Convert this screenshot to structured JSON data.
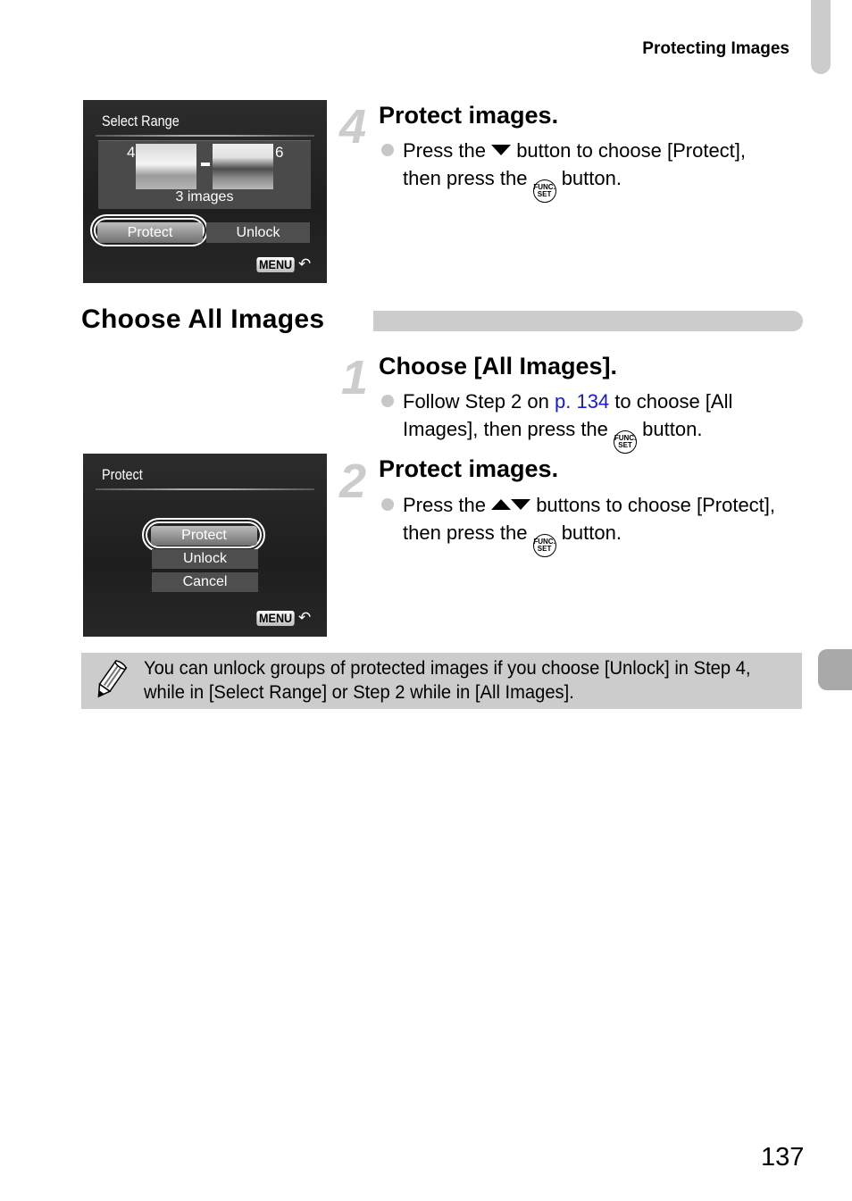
{
  "header": {
    "section_title": "Protecting Images"
  },
  "screen_select_range": {
    "title": "Select Range",
    "range_start": "4",
    "range_end": "6",
    "range_separator": "–",
    "count": "3 images",
    "buttons": [
      {
        "label": "Protect",
        "selected": true
      },
      {
        "label": "Unlock",
        "selected": false
      }
    ],
    "menu_label": "MENU",
    "back_glyph": "↶"
  },
  "step4": {
    "number": "4",
    "title": "Protect images.",
    "text_before": "Press the",
    "text_middle": "button to choose [Protect],",
    "text_line2_before": "then press the",
    "text_after": "button.",
    "func_icon": {
      "line1": "FUNC.",
      "line2": "SET"
    }
  },
  "section": {
    "title": "Choose All Images"
  },
  "step1": {
    "number": "1",
    "title": "Choose [All Images].",
    "text_before": "Follow Step 2 on",
    "link": "p. 134",
    "text_middle": "to choose [All",
    "text_line2_before": "Images], then press the",
    "text_after": "button."
  },
  "step2": {
    "number": "2",
    "title": "Protect images.",
    "text_before": "Press the",
    "text_middle": "buttons to choose [Protect],",
    "text_line2_before": "then press the",
    "text_after": "button."
  },
  "screen_protect": {
    "title": "Protect",
    "options": [
      {
        "label": "Protect",
        "selected": true
      },
      {
        "label": "Unlock",
        "selected": false
      },
      {
        "label": "Cancel",
        "selected": false
      }
    ],
    "menu_label": "MENU",
    "back_glyph": "↶"
  },
  "note": {
    "icon": "pencil-icon",
    "text": "You can unlock groups of protected images if you choose [Unlock] in Step 4, while in [Select Range] or Step 2 while in [All Images]."
  },
  "footer": {
    "page_number": "137"
  }
}
